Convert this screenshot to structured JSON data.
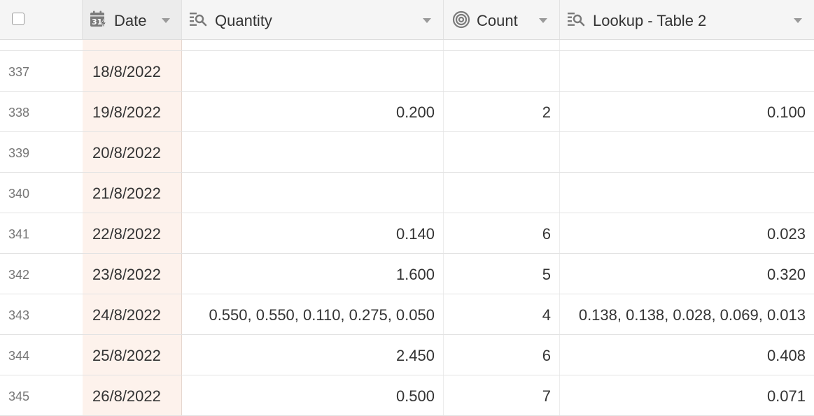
{
  "columns": {
    "date": {
      "label": "Date",
      "icon": "date-formula-icon"
    },
    "quantity": {
      "label": "Quantity",
      "icon": "lookup-icon"
    },
    "count": {
      "label": "Count",
      "icon": "count-icon"
    },
    "lookup": {
      "label": "Lookup - Table 2",
      "icon": "lookup-icon"
    }
  },
  "colors": {
    "date_column_bg": "#fdf2ec",
    "header_bg": "#f5f5f5",
    "grid_line": "#e3e3e3"
  },
  "rows": [
    {
      "num": "337",
      "date": "18/8/2022",
      "quantity": "",
      "count": "",
      "lookup": ""
    },
    {
      "num": "338",
      "date": "19/8/2022",
      "quantity": "0.200",
      "count": "2",
      "lookup": "0.100"
    },
    {
      "num": "339",
      "date": "20/8/2022",
      "quantity": "",
      "count": "",
      "lookup": ""
    },
    {
      "num": "340",
      "date": "21/8/2022",
      "quantity": "",
      "count": "",
      "lookup": ""
    },
    {
      "num": "341",
      "date": "22/8/2022",
      "quantity": "0.140",
      "count": "6",
      "lookup": "0.023"
    },
    {
      "num": "342",
      "date": "23/8/2022",
      "quantity": "1.600",
      "count": "5",
      "lookup": "0.320"
    },
    {
      "num": "343",
      "date": "24/8/2022",
      "quantity": "0.550, 0.550, 0.110, 0.275, 0.050",
      "count": "4",
      "lookup": "0.138, 0.138, 0.028, 0.069, 0.013"
    },
    {
      "num": "344",
      "date": "25/8/2022",
      "quantity": "2.450",
      "count": "6",
      "lookup": "0.408"
    },
    {
      "num": "345",
      "date": "26/8/2022",
      "quantity": "0.500",
      "count": "7",
      "lookup": "0.071"
    }
  ]
}
